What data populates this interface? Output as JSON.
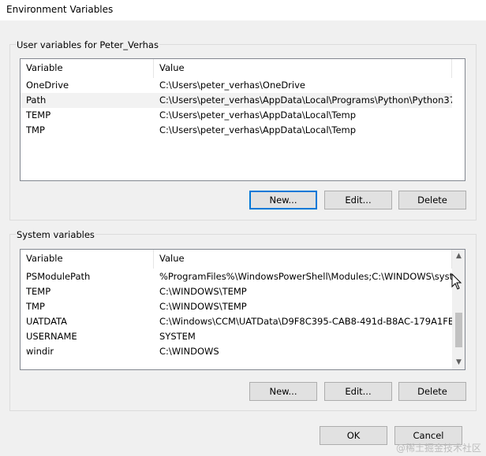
{
  "window": {
    "title": "Environment Variables"
  },
  "user_group": {
    "label": "User variables for Peter_Verhas",
    "columns": [
      "Variable",
      "Value"
    ],
    "rows": [
      {
        "variable": "OneDrive",
        "value": "C:\\Users\\peter_verhas\\OneDrive",
        "selected": false
      },
      {
        "variable": "Path",
        "value": "C:\\Users\\peter_verhas\\AppData\\Local\\Programs\\Python\\Python37...",
        "selected": true
      },
      {
        "variable": "TEMP",
        "value": "C:\\Users\\peter_verhas\\AppData\\Local\\Temp",
        "selected": false
      },
      {
        "variable": "TMP",
        "value": "C:\\Users\\peter_verhas\\AppData\\Local\\Temp",
        "selected": false
      }
    ],
    "buttons": {
      "new": "New...",
      "edit": "Edit...",
      "delete": "Delete"
    }
  },
  "system_group": {
    "label": "System variables",
    "columns": [
      "Variable",
      "Value"
    ],
    "rows": [
      {
        "variable": "PSModulePath",
        "value": "%ProgramFiles%\\WindowsPowerShell\\Modules;C:\\WINDOWS\\syst..."
      },
      {
        "variable": "TEMP",
        "value": "C:\\WINDOWS\\TEMP"
      },
      {
        "variable": "TMP",
        "value": "C:\\WINDOWS\\TEMP"
      },
      {
        "variable": "UATDATA",
        "value": "C:\\Windows\\CCM\\UATData\\D9F8C395-CAB8-491d-B8AC-179A1FE..."
      },
      {
        "variable": "USERNAME",
        "value": "SYSTEM"
      },
      {
        "variable": "windir",
        "value": "C:\\WINDOWS"
      }
    ],
    "buttons": {
      "new": "New...",
      "edit": "Edit...",
      "delete": "Delete"
    },
    "scroll_position": 0.85
  },
  "dialog_buttons": {
    "ok": "OK",
    "cancel": "Cancel"
  },
  "watermark": "@稀土掘金技术社区",
  "colors": {
    "focus_border": "#0078d7",
    "selected_row": "#f2f2f2",
    "button_face": "#e1e1e1"
  }
}
